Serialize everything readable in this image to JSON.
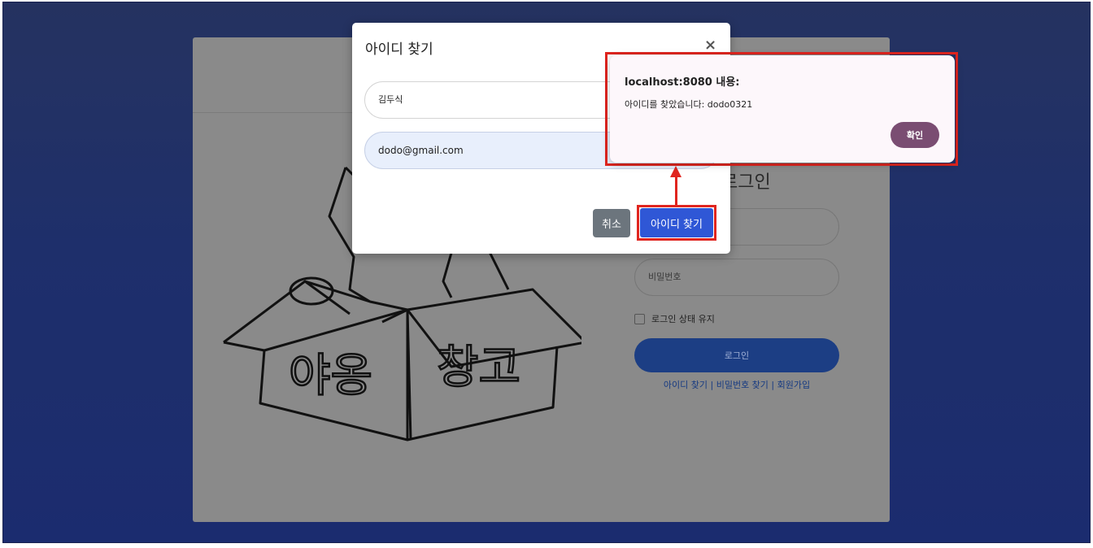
{
  "login": {
    "title": "로그인",
    "password_placeholder": "비밀번호",
    "remember_label": "로그인 상태 유지",
    "login_button": "로그인",
    "links": {
      "find_id": "아이디 찾기",
      "find_password": "비밀번호 찾기",
      "signup": "회원가입",
      "separator": "|"
    },
    "logo_text_left": "야옹",
    "logo_text_right": "창고"
  },
  "modal": {
    "title": "아이디 찾기",
    "close": "×",
    "name_value": "김두식",
    "email_value": "dodo@gmail.com",
    "cancel_button": "취소",
    "submit_button": "아이디 찾기"
  },
  "alert": {
    "title": "localhost:8080 내용:",
    "message": "아이디를 찾았습니다: dodo0321",
    "ok_button": "확인"
  },
  "colors": {
    "background": "#23367a",
    "primary_button": "#2f57d6",
    "cancel_button": "#6c757d",
    "alert_ok": "#7a4d72",
    "highlight": "#e0251f"
  }
}
